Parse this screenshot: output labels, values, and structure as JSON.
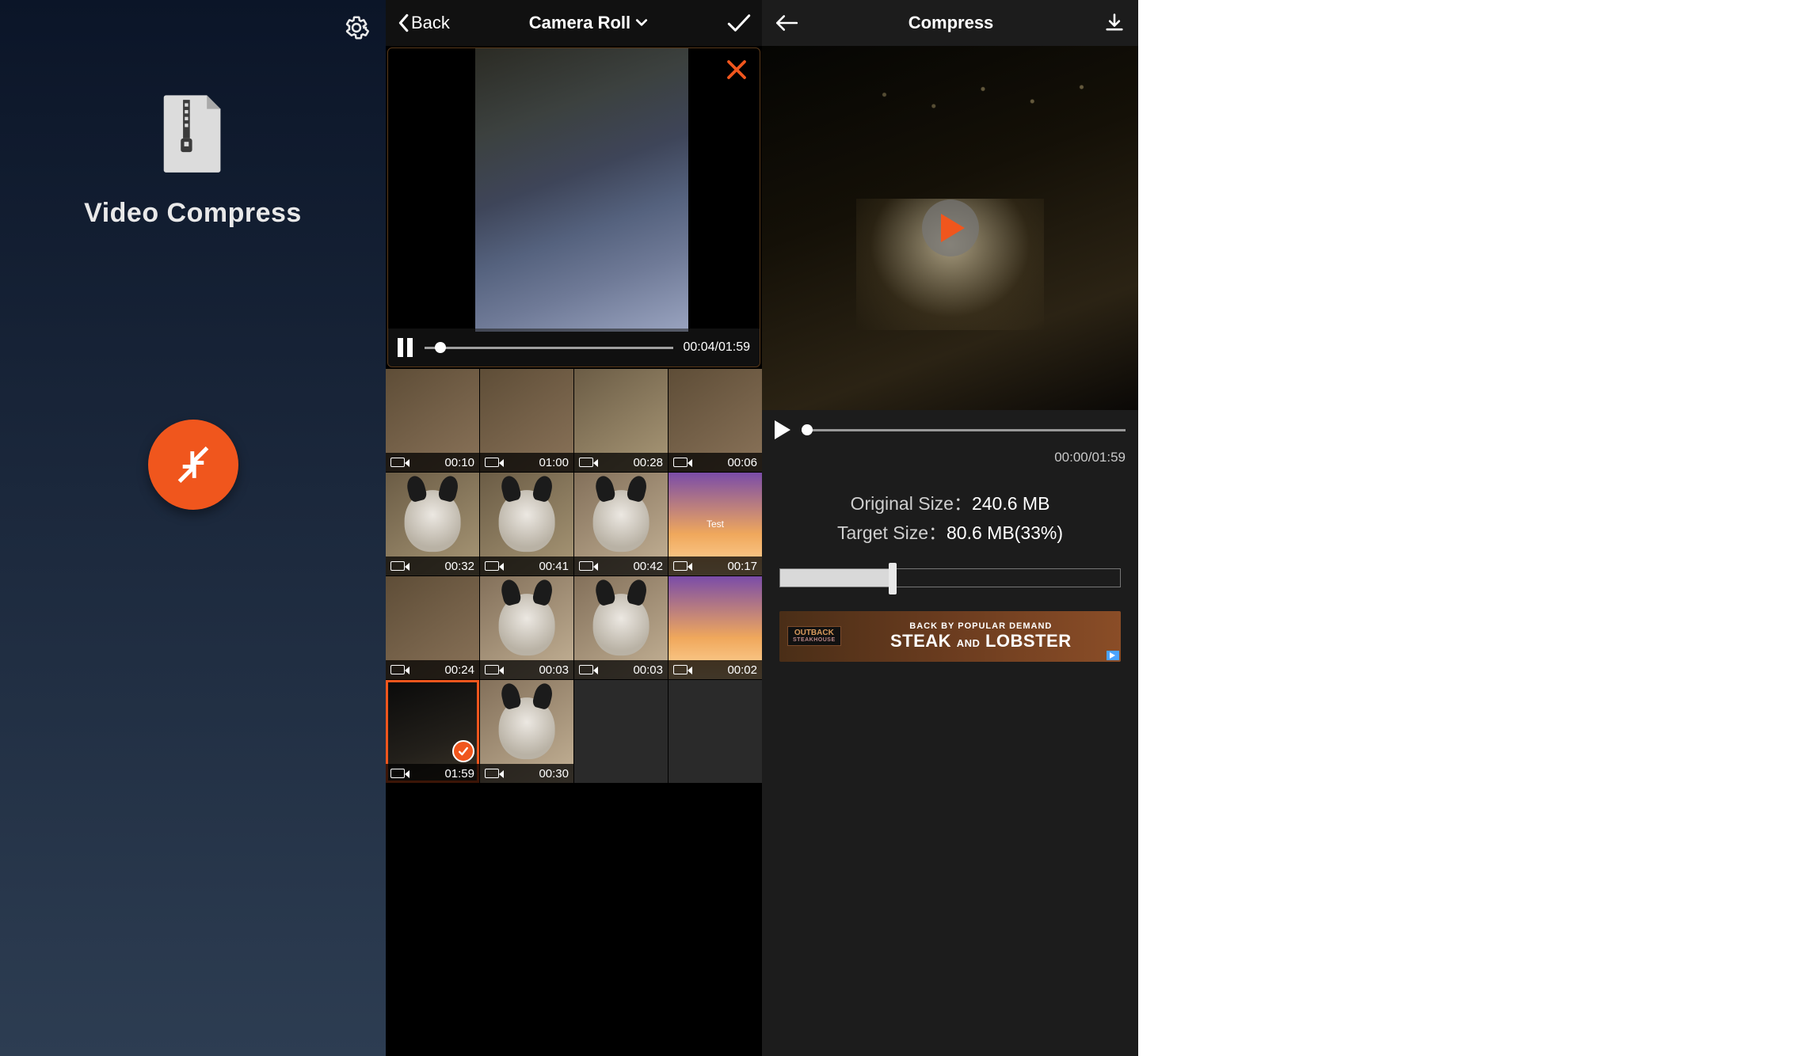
{
  "colors": {
    "accent": "#f0561d"
  },
  "screen1": {
    "title": "Video Compress",
    "gear_icon": "gear",
    "zip_icon": "zip-file",
    "compress_icon": "compress-arrows"
  },
  "screen2": {
    "back_label": "Back",
    "album_title": "Camera Roll",
    "confirm_icon": "checkmark",
    "close_icon": "x",
    "playback": {
      "state": "paused",
      "elapsed": "00:04",
      "total": "01:59",
      "display": "00:04/01:59"
    },
    "thumbs": [
      {
        "duration": "00:10",
        "selected": false,
        "bg": "a"
      },
      {
        "duration": "01:00",
        "selected": false,
        "bg": "a"
      },
      {
        "duration": "00:28",
        "selected": false,
        "bg": "b"
      },
      {
        "duration": "00:06",
        "selected": false,
        "bg": "a"
      },
      {
        "duration": "00:32",
        "selected": false,
        "bg": "b",
        "dog": true
      },
      {
        "duration": "00:41",
        "selected": false,
        "bg": "b",
        "dog": true
      },
      {
        "duration": "00:42",
        "selected": false,
        "bg": "c",
        "dog": true
      },
      {
        "duration": "00:17",
        "selected": false,
        "bg": "d",
        "label": "Test"
      },
      {
        "duration": "00:24",
        "selected": false,
        "bg": "a"
      },
      {
        "duration": "00:03",
        "selected": false,
        "bg": "c",
        "dog": true
      },
      {
        "duration": "00:03",
        "selected": false,
        "bg": "c",
        "dog": true
      },
      {
        "duration": "00:02",
        "selected": false,
        "bg": "d"
      },
      {
        "duration": "01:59",
        "selected": true,
        "bg": "e"
      },
      {
        "duration": "00:30",
        "selected": false,
        "bg": "c",
        "dog": true
      },
      {
        "empty": true
      },
      {
        "empty": true
      }
    ]
  },
  "screen3": {
    "title": "Compress",
    "back_icon": "arrow-left",
    "download_icon": "download",
    "playback": {
      "state": "stopped",
      "elapsed": "00:00",
      "total": "01:59",
      "display": "00:00/01:59"
    },
    "original_size_label": "Original Size：",
    "original_size_value": "240.6 MB",
    "target_size_label": "Target Size：",
    "target_size_value": "80.6 MB(33%)",
    "slider_percent": 33,
    "ad": {
      "brand_top": "OUTBACK",
      "brand_sub": "STEAKHOUSE",
      "line1": "BACK BY POPULAR DEMAND",
      "line2_a": "STEAK",
      "line2_and": "AND",
      "line2_b": "LOBSTER",
      "badge_icon": "adchoices"
    }
  }
}
